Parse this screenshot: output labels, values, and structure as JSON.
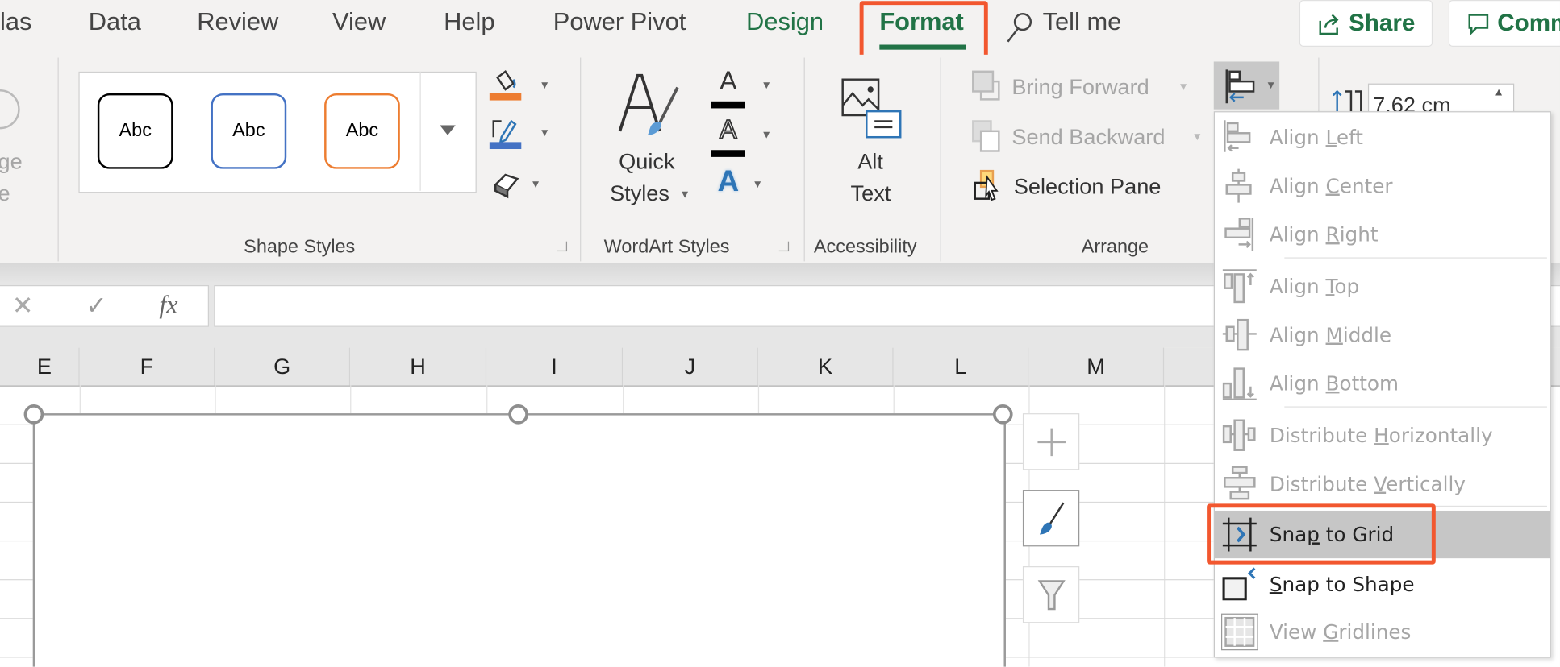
{
  "tabs": [
    {
      "label": "las"
    },
    {
      "label": "Data"
    },
    {
      "label": "Review"
    },
    {
      "label": "View"
    },
    {
      "label": "Help"
    },
    {
      "label": "Power Pivot"
    },
    {
      "label": "Design"
    },
    {
      "label": "Format",
      "active": true
    }
  ],
  "tell_me": "Tell me",
  "share": "Share",
  "comments": "Comm",
  "partial_group": {
    "line1": "ge",
    "line2": "e"
  },
  "shape_styles": {
    "label": "Shape Styles",
    "samples": [
      "Abc",
      "Abc",
      "Abc"
    ],
    "sample_colors": [
      "#000000",
      "#4472c4",
      "#ed7d31"
    ],
    "fill_color": "#ed7d31",
    "outline_color": "#4472c4"
  },
  "wordart": {
    "label": "WordArt Styles",
    "quick_styles_line1": "Quick",
    "quick_styles_line2": "Styles",
    "text_fill_color": "#000000",
    "text_outline_color": "#000000",
    "text_effects_color": "#2e75b6"
  },
  "accessibility": {
    "label": "Accessibility",
    "alt_line1": "Alt",
    "alt_line2": "Text"
  },
  "arrange": {
    "label": "Arrange",
    "bring_forward": "Bring Forward",
    "send_backward": "Send Backward",
    "selection_pane": "Selection Pane"
  },
  "size": {
    "height": "7.62 cm"
  },
  "formula_bar": {
    "cancel": "✕",
    "enter": "✓",
    "fx": "fx",
    "value": ""
  },
  "columns": [
    "E",
    "F",
    "G",
    "H",
    "I",
    "J",
    "K",
    "L",
    "M"
  ],
  "align_menu": {
    "items": [
      {
        "pre": "Align ",
        "key": "L",
        "post": "eft",
        "icon": "align-left-icon",
        "enabled": false
      },
      {
        "pre": "Align ",
        "key": "C",
        "post": "enter",
        "icon": "align-center-icon",
        "enabled": false
      },
      {
        "pre": "Align ",
        "key": "R",
        "post": "ight",
        "icon": "align-right-icon",
        "enabled": false
      },
      {
        "pre": "Align ",
        "key": "T",
        "post": "op",
        "icon": "align-top-icon",
        "enabled": false
      },
      {
        "pre": "Align ",
        "key": "M",
        "post": "iddle",
        "icon": "align-middle-icon",
        "enabled": false
      },
      {
        "pre": "Align ",
        "key": "B",
        "post": "ottom",
        "icon": "align-bottom-icon",
        "enabled": false
      },
      {
        "pre": "Distribute ",
        "key": "H",
        "post": "orizontally",
        "icon": "distribute-horizontally-icon",
        "enabled": false
      },
      {
        "pre": "Distribute ",
        "key": "V",
        "post": "ertically",
        "icon": "distribute-vertically-icon",
        "enabled": false
      },
      {
        "pre": "Sna",
        "key": "p",
        "post": " to Grid",
        "icon": "snap-to-grid-icon",
        "enabled": true,
        "highlighted": true
      },
      {
        "pre": "",
        "key": "S",
        "post": "nap to Shape",
        "icon": "snap-to-shape-icon",
        "enabled": true
      },
      {
        "pre": "View ",
        "key": "G",
        "post": "ridlines",
        "icon": "view-gridlines-icon",
        "enabled": false
      }
    ]
  },
  "colors": {
    "accent": "#217346",
    "highlight_box": "#f2572f"
  }
}
